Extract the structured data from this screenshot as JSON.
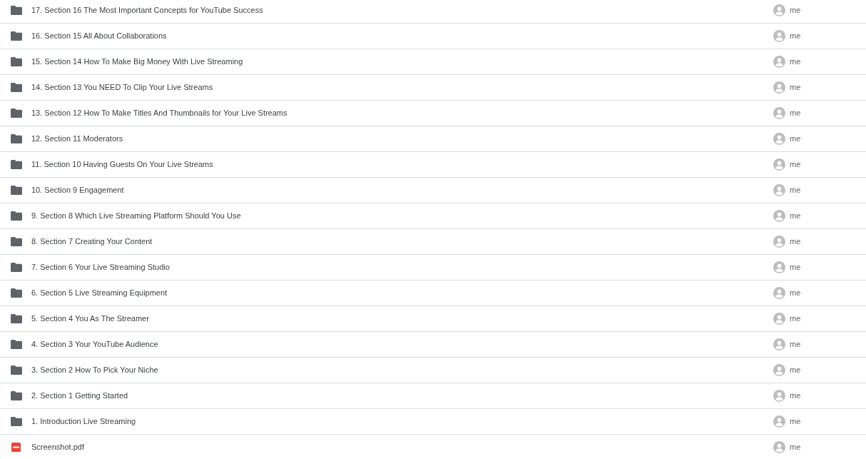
{
  "files": [
    {
      "kind": "folder",
      "name": "17. Section 16 The Most Important Concepts for YouTube Success",
      "owner": "me"
    },
    {
      "kind": "folder",
      "name": "16. Section 15 All About Collaborations",
      "owner": "me"
    },
    {
      "kind": "folder",
      "name": "15. Section 14 How To Make Big Money With Live Streaming",
      "owner": "me"
    },
    {
      "kind": "folder",
      "name": "14. Section 13 You NEED To Clip Your Live Streams",
      "owner": "me"
    },
    {
      "kind": "folder",
      "name": "13. Section 12 How To Make Titles And Thumbnails for Your Live Streams",
      "owner": "me"
    },
    {
      "kind": "folder",
      "name": "12. Section 11 Moderators",
      "owner": "me"
    },
    {
      "kind": "folder",
      "name": "11. Section 10 Having Guests On Your Live Streams",
      "owner": "me"
    },
    {
      "kind": "folder",
      "name": "10. Section 9 Engagement",
      "owner": "me"
    },
    {
      "kind": "folder",
      "name": "9. Section 8 Which Live Streaming Platform Should You Use",
      "owner": "me"
    },
    {
      "kind": "folder",
      "name": "8. Section 7 Creating Your Content",
      "owner": "me"
    },
    {
      "kind": "folder",
      "name": "7. Section 6 Your Live Streaming Studio",
      "owner": "me"
    },
    {
      "kind": "folder",
      "name": "6. Section 5 Live Streaming Equipment",
      "owner": "me"
    },
    {
      "kind": "folder",
      "name": "5. Section 4 You As The Streamer",
      "owner": "me"
    },
    {
      "kind": "folder",
      "name": "4. Section 3 Your YouTube Audience",
      "owner": "me"
    },
    {
      "kind": "folder",
      "name": "3. Section 2 How To Pick Your Niche",
      "owner": "me"
    },
    {
      "kind": "folder",
      "name": "2. Section 1 Getting Started",
      "owner": "me"
    },
    {
      "kind": "folder",
      "name": "1. Introduction Live Streaming",
      "owner": "me"
    },
    {
      "kind": "pdf",
      "name": "Screenshot.pdf",
      "owner": "me"
    }
  ]
}
